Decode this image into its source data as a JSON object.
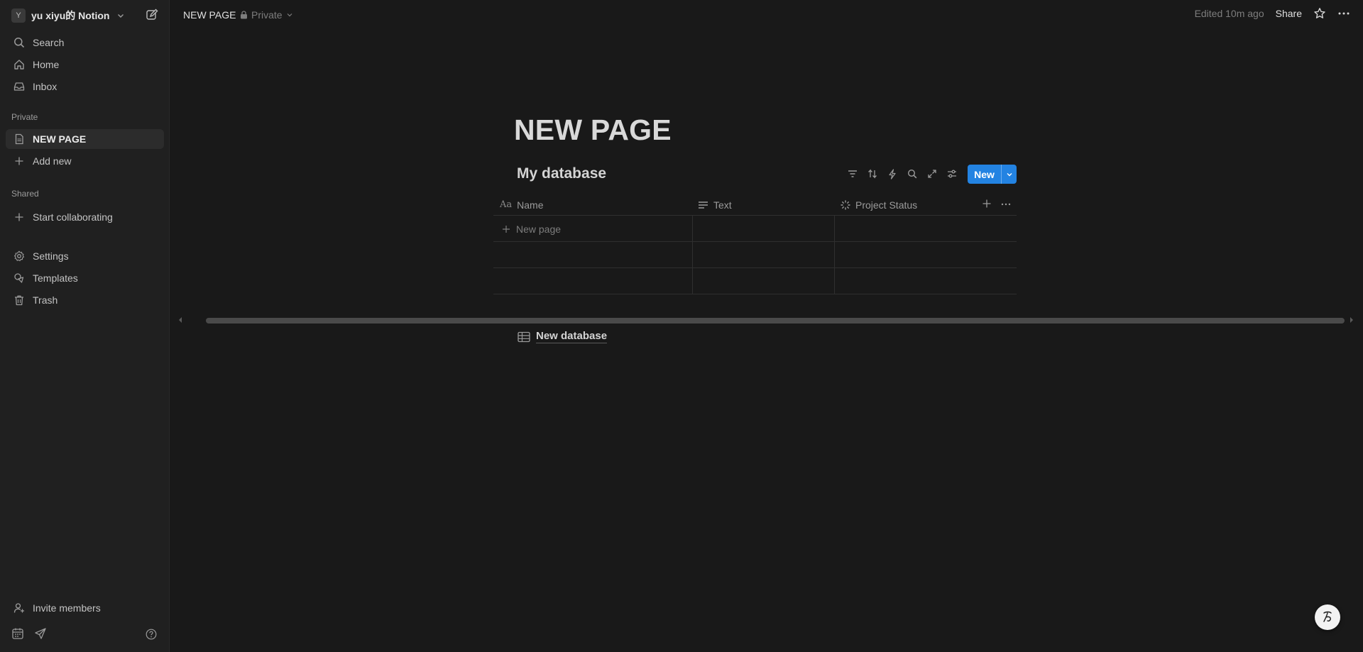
{
  "workspace": {
    "avatar_letter": "Y",
    "name": "yu xiyu的 Notion"
  },
  "sidebar": {
    "top_items": [
      {
        "label": "Search",
        "icon": "search-icon"
      },
      {
        "label": "Home",
        "icon": "home-icon"
      },
      {
        "label": "Inbox",
        "icon": "inbox-icon"
      }
    ],
    "private_header": "Private",
    "private_items": [
      {
        "label": "NEW PAGE",
        "icon": "page-icon",
        "active": true
      },
      {
        "label": "Add new",
        "icon": "plus-icon"
      }
    ],
    "shared_header": "Shared",
    "shared_items": [
      {
        "label": "Start collaborating",
        "icon": "plus-icon"
      }
    ],
    "bottom_items": [
      {
        "label": "Settings",
        "icon": "gear-icon"
      },
      {
        "label": "Templates",
        "icon": "templates-icon"
      },
      {
        "label": "Trash",
        "icon": "trash-icon"
      }
    ],
    "invite_label": "Invite members"
  },
  "topbar": {
    "page_title": "NEW PAGE",
    "privacy": "Private",
    "edited": "Edited 10m ago",
    "share": "Share"
  },
  "page": {
    "title": "NEW PAGE"
  },
  "database": {
    "title": "My database",
    "new_button": "New",
    "columns": [
      {
        "label": "Name",
        "icon": "text-aa-icon"
      },
      {
        "label": "Text",
        "icon": "lines-icon"
      },
      {
        "label": "Project Status",
        "icon": "status-icon"
      }
    ],
    "new_page_label": "New page"
  },
  "linked_database": {
    "label": "New database"
  },
  "colors": {
    "background": "#191919",
    "sidebar": "#202020",
    "accent": "#2383e2"
  }
}
